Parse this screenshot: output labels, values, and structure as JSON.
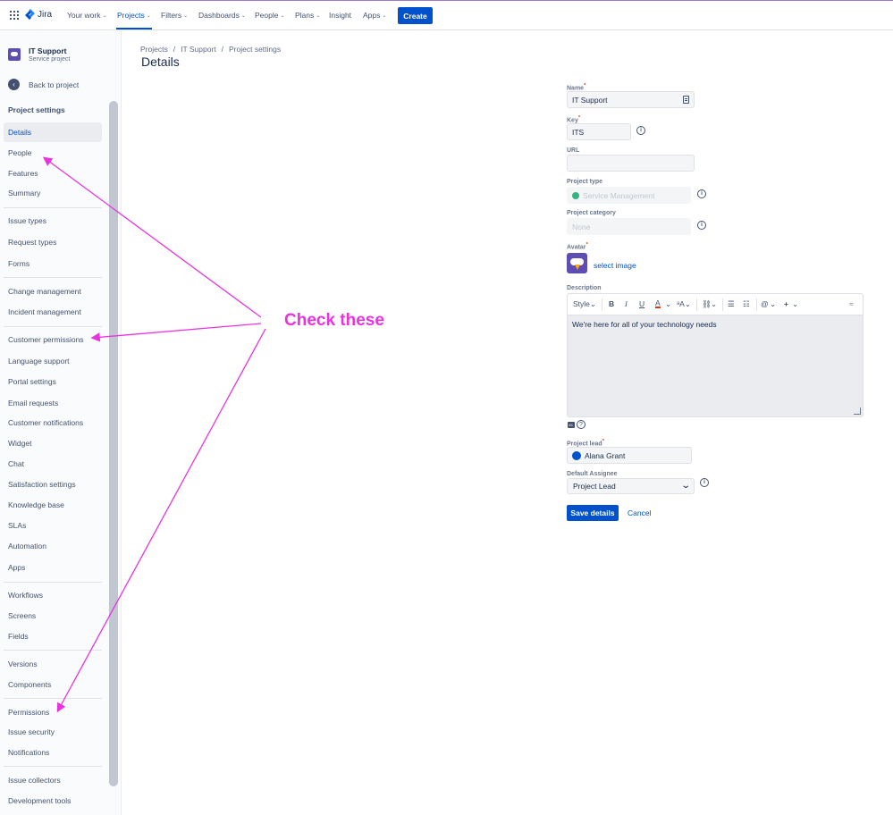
{
  "topnav": {
    "logo_text": "Jira",
    "items": [
      {
        "label": "Your work"
      },
      {
        "label": "Projects"
      },
      {
        "label": "Filters"
      },
      {
        "label": "Dashboards"
      },
      {
        "label": "People"
      },
      {
        "label": "Plans"
      },
      {
        "label": "Insight"
      },
      {
        "label": "Apps"
      }
    ],
    "create_label": "Create",
    "chevron": "⌄"
  },
  "sidebar": {
    "project_name": "IT Support",
    "project_type": "Service project",
    "back_label": "Back to project",
    "heading": "Project settings",
    "items": [
      {
        "label": "Details"
      },
      {
        "label": "People"
      },
      {
        "label": "Features"
      },
      {
        "label": "Summary"
      },
      {
        "label": "Issue types"
      },
      {
        "label": "Request types"
      },
      {
        "label": "Forms"
      },
      {
        "label": "Change management"
      },
      {
        "label": "Incident management"
      },
      {
        "label": "Customer permissions"
      },
      {
        "label": "Language support"
      },
      {
        "label": "Portal settings"
      },
      {
        "label": "Email requests"
      },
      {
        "label": "Customer notifications"
      },
      {
        "label": "Widget"
      },
      {
        "label": "Chat"
      },
      {
        "label": "Satisfaction settings"
      },
      {
        "label": "Knowledge base"
      },
      {
        "label": "SLAs"
      },
      {
        "label": "Automation"
      },
      {
        "label": "Apps"
      },
      {
        "label": "Workflows"
      },
      {
        "label": "Screens"
      },
      {
        "label": "Fields"
      },
      {
        "label": "Versions"
      },
      {
        "label": "Components"
      },
      {
        "label": "Permissions"
      },
      {
        "label": "Issue security"
      },
      {
        "label": "Notifications"
      },
      {
        "label": "Issue collectors"
      },
      {
        "label": "Development tools"
      }
    ]
  },
  "breadcrumb": {
    "items": [
      "Projects",
      "IT Support",
      "Project settings"
    ],
    "separator": "/"
  },
  "page_title": "Details",
  "form": {
    "required_mark": "*",
    "name_label": "Name",
    "name_value": "IT Support",
    "key_label": "Key",
    "key_value": "ITS",
    "url_label": "URL",
    "url_value": "",
    "project_type_label": "Project type",
    "project_type_value": "Service Management",
    "project_category_label": "Project category",
    "project_category_value": "None",
    "avatar_label": "Avatar",
    "select_image_label": "select image",
    "description_label": "Description",
    "description_value": "We're here for all of your technology needs",
    "toolbar": {
      "style": "Style",
      "bold": "B",
      "italic": "I",
      "underline": "U",
      "text_color": "A",
      "more_format": "ᵃA"
    },
    "project_lead_label": "Project lead",
    "project_lead_value": "Alana Grant",
    "default_assignee_label": "Default Assignee",
    "default_assignee_value": "Project Lead",
    "save_label": "Save details",
    "cancel_label": "Cancel",
    "info_glyph": "i",
    "help_glyph": "?"
  },
  "annotation": {
    "text": "Check these",
    "color": "#e933e0"
  },
  "colors": {
    "brand": "#0052cc",
    "annotation": "#e933e0"
  }
}
